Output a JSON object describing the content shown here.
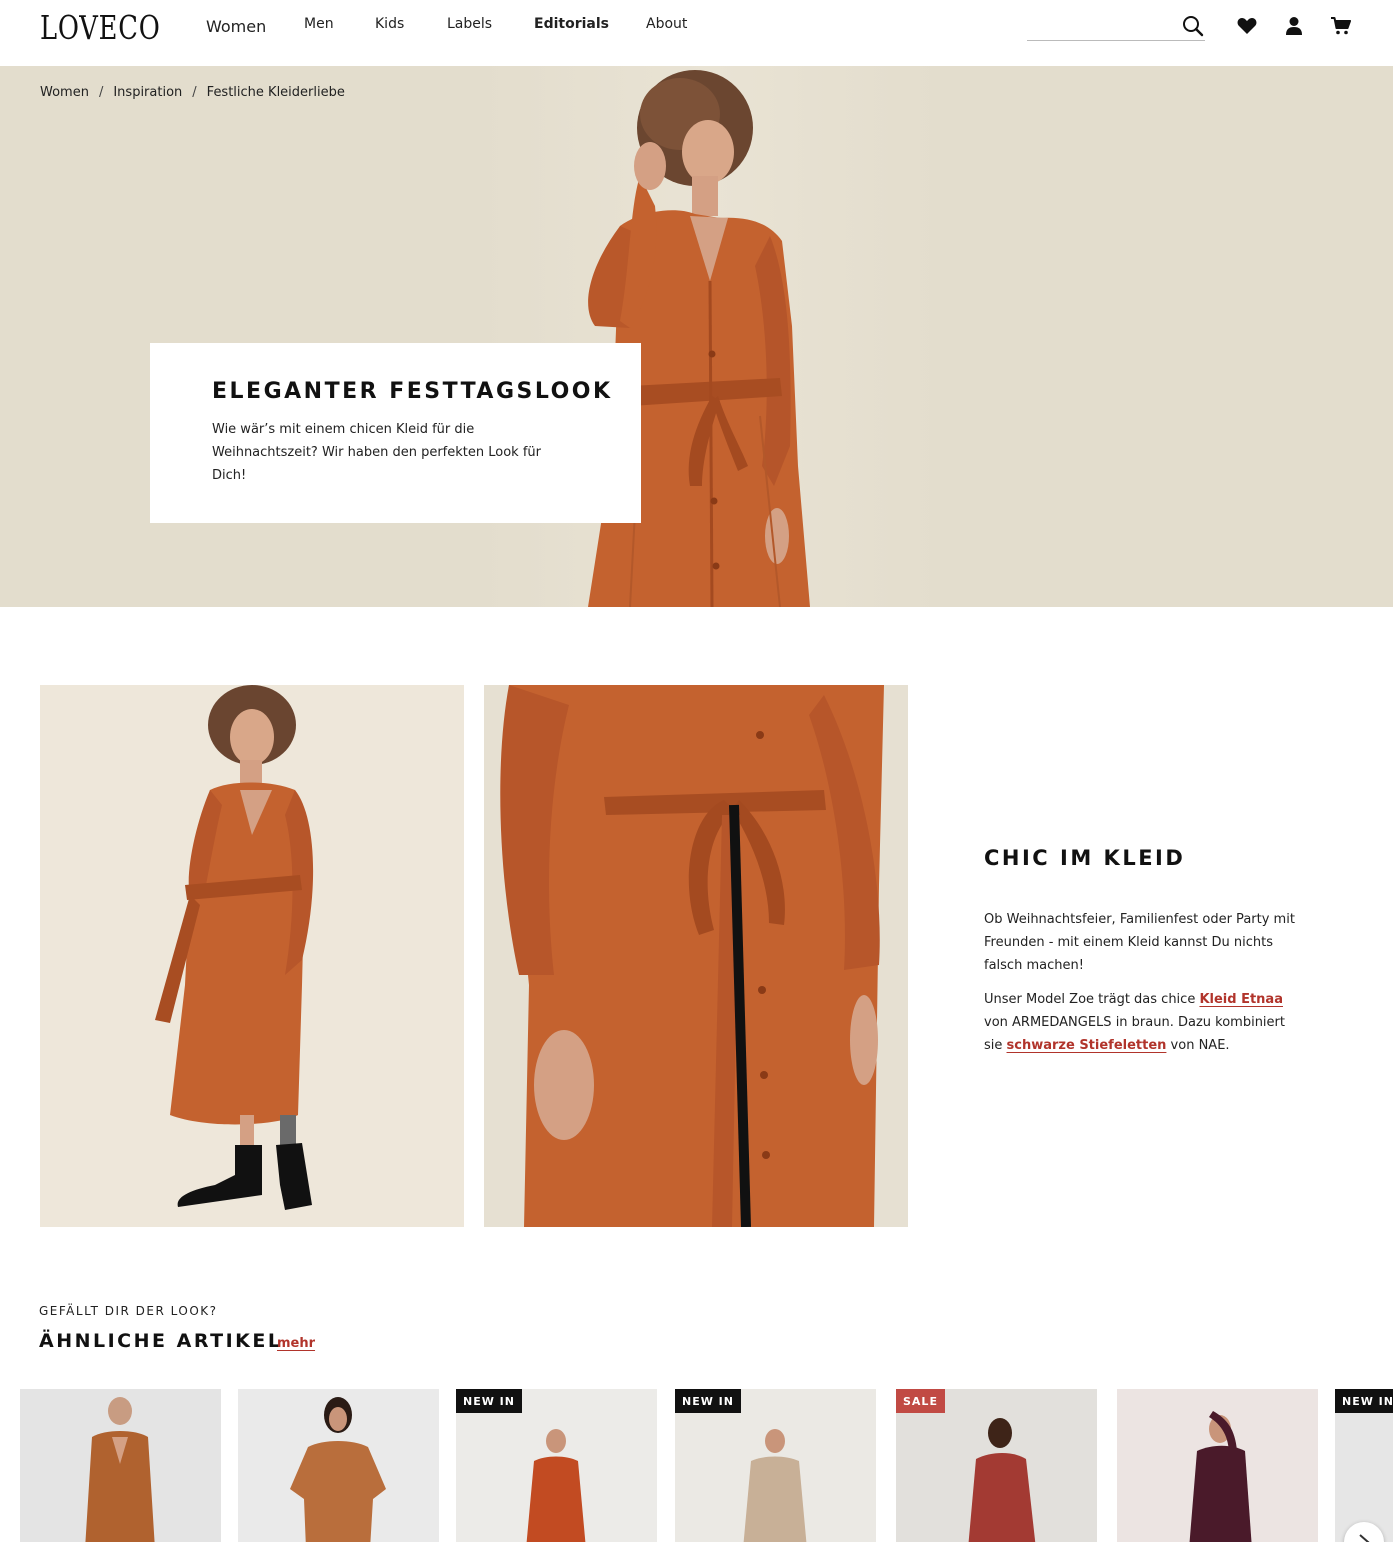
{
  "brand": {
    "logo": "LOVECO"
  },
  "nav": {
    "items": [
      {
        "label": "Women"
      },
      {
        "label": "Men"
      },
      {
        "label": "Kids"
      },
      {
        "label": "Labels"
      },
      {
        "label": "Editorials"
      },
      {
        "label": "About"
      }
    ]
  },
  "header": {
    "search_placeholder": "",
    "icons": [
      "search-icon",
      "heart-icon",
      "user-icon",
      "cart-icon"
    ]
  },
  "breadcrumb": {
    "items": [
      "Women",
      "Inspiration",
      "Festliche Kleiderliebe"
    ],
    "separator": "/"
  },
  "hero": {
    "title": "ELEGANTER FESTTAGSLOOK",
    "text": "Wie wär’s mit einem chicen Kleid für die Weihnachtszeit? Wir haben den perfekten Look für Dich!"
  },
  "look": {
    "title": "CHIC IM KLEID",
    "paragraph1": "Ob Weihnachtsfeier, Familienfest oder Party mit Freunden - mit einem Kleid kannst Du nichts falsch machen!",
    "p2_part1": "Unser Model Zoe trägt das chice ",
    "p2_link1": "Kleid Etnaa",
    "p2_part2": " von ARMEDANGELS in braun. Dazu kombiniert sie ",
    "p2_link2": "schwarze Stiefeletten",
    "p2_part3": " von NAE."
  },
  "similar": {
    "kicker": "GEFÄLLT DIR DER LOOK?",
    "title": "ÄHNLICHE ARTIKEL",
    "more": "mehr",
    "products": [
      {
        "badge": ""
      },
      {
        "badge": ""
      },
      {
        "badge": "NEW IN"
      },
      {
        "badge": "NEW IN"
      },
      {
        "badge": "SALE"
      },
      {
        "badge": ""
      },
      {
        "badge": "NEW IN"
      }
    ]
  },
  "colors": {
    "hero_bg": "#e3ddcd",
    "dress": "#c4622f",
    "accent_link": "#b1342b",
    "sale_badge": "#c14a44"
  }
}
